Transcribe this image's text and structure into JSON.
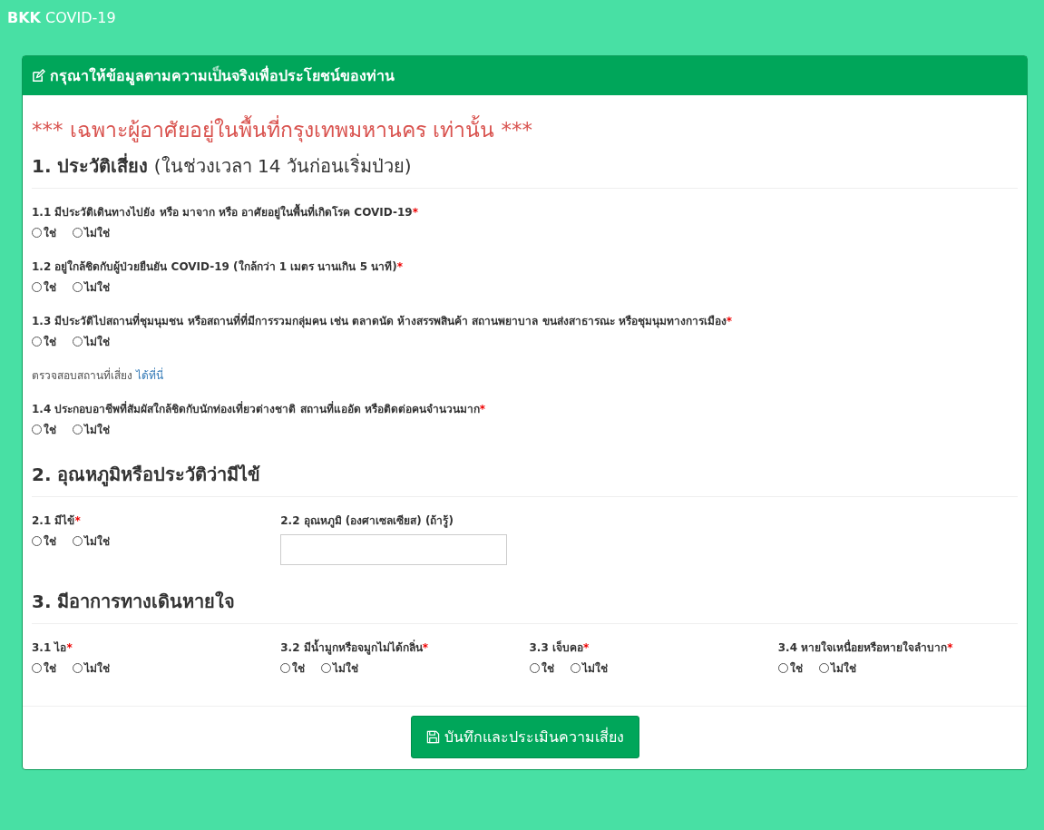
{
  "navbar": {
    "brand": "**BKK** COVID-19"
  },
  "panel": {
    "title": "กรุณาให้ข้อมูลตามความเป็นจริงเพื่อประโยชน์ของท่าน",
    "notice": "*** เฉพาะผู้อาศัยอยู่ในพื้นที่กรุงเทพมหานคร เท่านั้น ***",
    "sections": [
      {
        "title": "**1. ประวัติเสี่ยง** (ในช่วงเวลา 14 วันก่อนเริ่มป่วย)",
        "kind": "rows",
        "items": [
          {
            "kind": "radio",
            "label": "1.1 มีประวัติเดินทางไปยัง หรือ มาจาก หรือ อาศัยอยู่ในพื้นที่เกิดโรค COVID-19",
            "required_mark": "*",
            "options": [
              {
                "label": "ใช่",
                "selected": false
              },
              {
                "label": "ไม่ใช่",
                "selected": false
              }
            ]
          },
          {
            "kind": "radio",
            "label": "1.2 อยู่ใกล้ชิดกับผู้ป่วยยืนยัน COVID-19 (ใกล้กว่า 1 เมตร นานเกิน 5 นาที)",
            "required_mark": "*",
            "options": [
              {
                "label": "ใช่",
                "selected": false
              },
              {
                "label": "ไม่ใช่",
                "selected": false
              }
            ]
          },
          {
            "kind": "radio",
            "label": "1.3 มีประวัติไปสถานที่ชุมนุมชน หรือสถานที่ที่มีการรวมกลุ่มคน เช่น ตลาดนัด ห้างสรรพสินค้า สถานพยาบาล ขนส่งสาธารณะ หรือชุมนุมทางการเมือง",
            "required_mark": "*",
            "options": [
              {
                "label": "ใช่",
                "selected": false
              },
              {
                "label": "ไม่ใช่",
                "selected": false
              }
            ]
          },
          {
            "kind": "note",
            "text": "ตรวจสอบสถานที่เสี่ยง",
            "link": "ได้ที่นี่"
          },
          {
            "kind": "radio",
            "label": "1.4 ประกอบอาชีพที่สัมผัสใกล้ชิดกับนักท่องเที่ยวต่างชาติ สถานที่แออัด หรือติดต่อคนจำนวนมาก",
            "required_mark": "*",
            "options": [
              {
                "label": "ใช่",
                "selected": false
              },
              {
                "label": "ไม่ใช่",
                "selected": false
              }
            ]
          }
        ]
      },
      {
        "title": "2. อุณหภูมิหรือประวัติว่ามีไข้",
        "kind": "grid",
        "items": [
          {
            "kind": "radio",
            "label": "2.1 มีไข้",
            "required_mark": "*",
            "options": [
              {
                "label": "ใช่",
                "selected": false
              },
              {
                "label": "ไม่ใช่",
                "selected": false
              }
            ]
          },
          {
            "kind": "text",
            "label": "2.2 อุณหภูมิ (องศาเซลเซียส) (ถ้ารู้)"
          }
        ]
      },
      {
        "title": "3. มีอาการทางเดินหายใจ",
        "kind": "grid",
        "items": [
          {
            "kind": "radio",
            "label": "3.1 ไอ",
            "required_mark": "*",
            "options": [
              {
                "label": "ใช่",
                "selected": false
              },
              {
                "label": "ไม่ใช่",
                "selected": false
              }
            ]
          },
          {
            "kind": "radio",
            "label": "3.2 มีน้ำมูกหรือจมูกไม่ได้กลิ่น",
            "required_mark": "*",
            "options": [
              {
                "label": "ใช่",
                "selected": false
              },
              {
                "label": "ไม่ใช่",
                "selected": false
              }
            ]
          },
          {
            "kind": "radio",
            "label": "3.3 เจ็บคอ",
            "required_mark": "*",
            "options": [
              {
                "label": "ใช่",
                "selected": false
              },
              {
                "label": "ไม่ใช่",
                "selected": false
              }
            ]
          },
          {
            "kind": "radio",
            "label": "3.4 หายใจเหนื่อยหรือหายใจลำบาก",
            "required_mark": "*",
            "options": [
              {
                "label": "ใช่",
                "selected": false
              },
              {
                "label": "ไม่ใช่",
                "selected": false
              }
            ]
          }
        ]
      }
    ],
    "submit": "บันทึกและประเมินความเสี่ยง"
  }
}
